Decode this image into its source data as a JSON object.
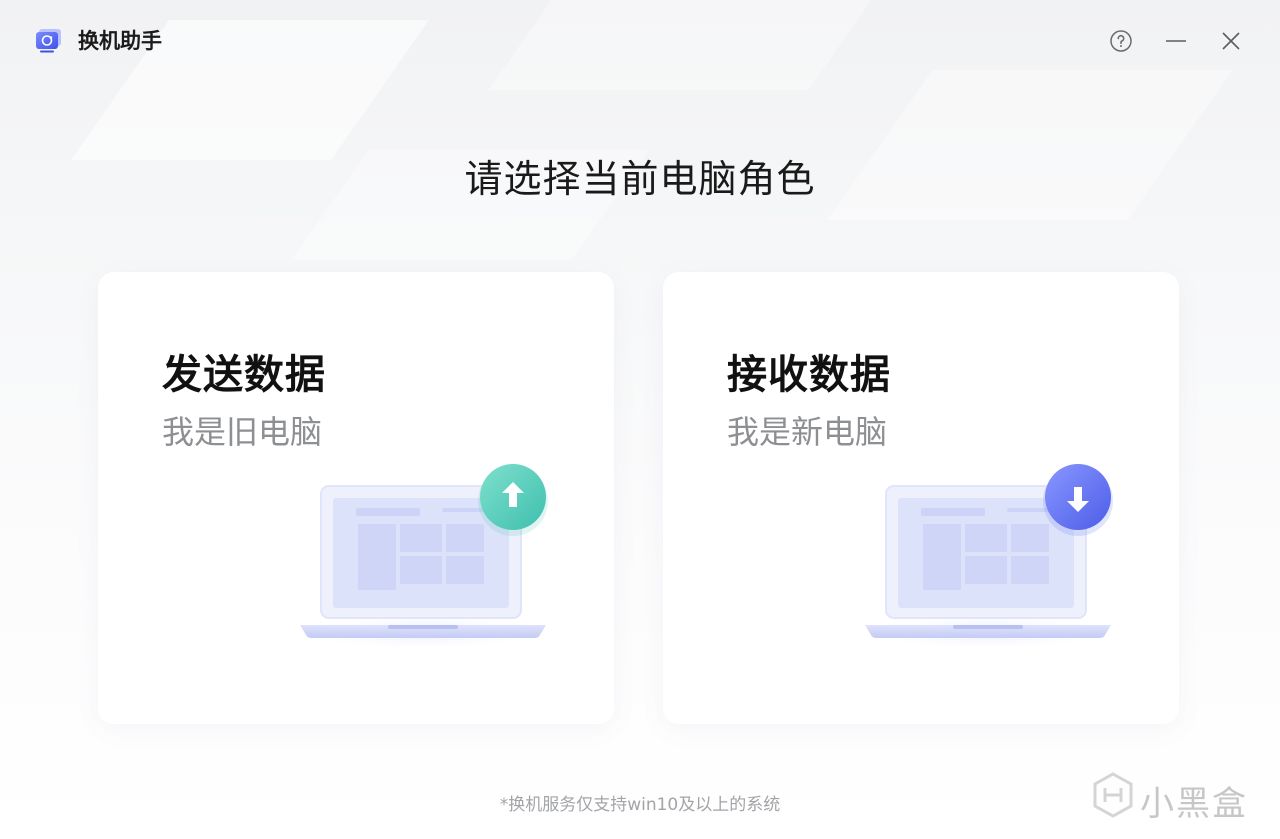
{
  "app": {
    "title": "换机助手",
    "logo_icon": "app-logo-icon"
  },
  "window_controls": {
    "help_icon": "help-icon",
    "minimize_icon": "minimize-icon",
    "close_icon": "close-icon"
  },
  "main": {
    "heading": "请选择当前电脑角色",
    "cards": [
      {
        "title": "发送数据",
        "subtitle": "我是旧电脑",
        "badge_icon": "upload-arrow-icon",
        "badge_color": "#4fc9b7"
      },
      {
        "title": "接收数据",
        "subtitle": "我是新电脑",
        "badge_icon": "download-arrow-icon",
        "badge_color": "#5b6ff0"
      }
    ],
    "footer_note": "*换机服务仅支持win10及以上的系统"
  },
  "watermark": {
    "text": "小黑盒"
  },
  "colors": {
    "accent_teal": "#4fc9b7",
    "accent_blue": "#5b6ff0",
    "laptop": "#dfe3fb"
  }
}
